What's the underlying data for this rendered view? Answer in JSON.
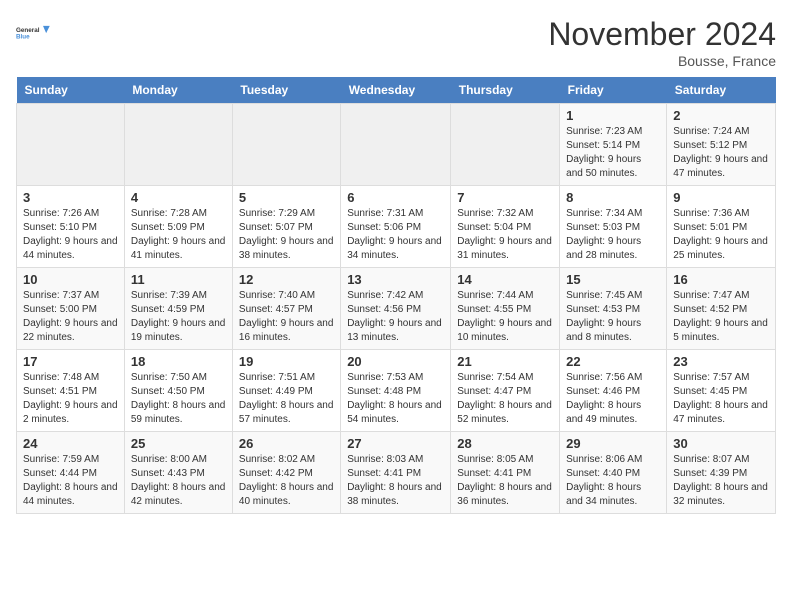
{
  "logo": {
    "line1": "General",
    "line2": "Blue"
  },
  "title": "November 2024",
  "location": "Bousse, France",
  "days_of_week": [
    "Sunday",
    "Monday",
    "Tuesday",
    "Wednesday",
    "Thursday",
    "Friday",
    "Saturday"
  ],
  "weeks": [
    [
      {
        "day": "",
        "info": ""
      },
      {
        "day": "",
        "info": ""
      },
      {
        "day": "",
        "info": ""
      },
      {
        "day": "",
        "info": ""
      },
      {
        "day": "",
        "info": ""
      },
      {
        "day": "1",
        "info": "Sunrise: 7:23 AM\nSunset: 5:14 PM\nDaylight: 9 hours and 50 minutes."
      },
      {
        "day": "2",
        "info": "Sunrise: 7:24 AM\nSunset: 5:12 PM\nDaylight: 9 hours and 47 minutes."
      }
    ],
    [
      {
        "day": "3",
        "info": "Sunrise: 7:26 AM\nSunset: 5:10 PM\nDaylight: 9 hours and 44 minutes."
      },
      {
        "day": "4",
        "info": "Sunrise: 7:28 AM\nSunset: 5:09 PM\nDaylight: 9 hours and 41 minutes."
      },
      {
        "day": "5",
        "info": "Sunrise: 7:29 AM\nSunset: 5:07 PM\nDaylight: 9 hours and 38 minutes."
      },
      {
        "day": "6",
        "info": "Sunrise: 7:31 AM\nSunset: 5:06 PM\nDaylight: 9 hours and 34 minutes."
      },
      {
        "day": "7",
        "info": "Sunrise: 7:32 AM\nSunset: 5:04 PM\nDaylight: 9 hours and 31 minutes."
      },
      {
        "day": "8",
        "info": "Sunrise: 7:34 AM\nSunset: 5:03 PM\nDaylight: 9 hours and 28 minutes."
      },
      {
        "day": "9",
        "info": "Sunrise: 7:36 AM\nSunset: 5:01 PM\nDaylight: 9 hours and 25 minutes."
      }
    ],
    [
      {
        "day": "10",
        "info": "Sunrise: 7:37 AM\nSunset: 5:00 PM\nDaylight: 9 hours and 22 minutes."
      },
      {
        "day": "11",
        "info": "Sunrise: 7:39 AM\nSunset: 4:59 PM\nDaylight: 9 hours and 19 minutes."
      },
      {
        "day": "12",
        "info": "Sunrise: 7:40 AM\nSunset: 4:57 PM\nDaylight: 9 hours and 16 minutes."
      },
      {
        "day": "13",
        "info": "Sunrise: 7:42 AM\nSunset: 4:56 PM\nDaylight: 9 hours and 13 minutes."
      },
      {
        "day": "14",
        "info": "Sunrise: 7:44 AM\nSunset: 4:55 PM\nDaylight: 9 hours and 10 minutes."
      },
      {
        "day": "15",
        "info": "Sunrise: 7:45 AM\nSunset: 4:53 PM\nDaylight: 9 hours and 8 minutes."
      },
      {
        "day": "16",
        "info": "Sunrise: 7:47 AM\nSunset: 4:52 PM\nDaylight: 9 hours and 5 minutes."
      }
    ],
    [
      {
        "day": "17",
        "info": "Sunrise: 7:48 AM\nSunset: 4:51 PM\nDaylight: 9 hours and 2 minutes."
      },
      {
        "day": "18",
        "info": "Sunrise: 7:50 AM\nSunset: 4:50 PM\nDaylight: 8 hours and 59 minutes."
      },
      {
        "day": "19",
        "info": "Sunrise: 7:51 AM\nSunset: 4:49 PM\nDaylight: 8 hours and 57 minutes."
      },
      {
        "day": "20",
        "info": "Sunrise: 7:53 AM\nSunset: 4:48 PM\nDaylight: 8 hours and 54 minutes."
      },
      {
        "day": "21",
        "info": "Sunrise: 7:54 AM\nSunset: 4:47 PM\nDaylight: 8 hours and 52 minutes."
      },
      {
        "day": "22",
        "info": "Sunrise: 7:56 AM\nSunset: 4:46 PM\nDaylight: 8 hours and 49 minutes."
      },
      {
        "day": "23",
        "info": "Sunrise: 7:57 AM\nSunset: 4:45 PM\nDaylight: 8 hours and 47 minutes."
      }
    ],
    [
      {
        "day": "24",
        "info": "Sunrise: 7:59 AM\nSunset: 4:44 PM\nDaylight: 8 hours and 44 minutes."
      },
      {
        "day": "25",
        "info": "Sunrise: 8:00 AM\nSunset: 4:43 PM\nDaylight: 8 hours and 42 minutes."
      },
      {
        "day": "26",
        "info": "Sunrise: 8:02 AM\nSunset: 4:42 PM\nDaylight: 8 hours and 40 minutes."
      },
      {
        "day": "27",
        "info": "Sunrise: 8:03 AM\nSunset: 4:41 PM\nDaylight: 8 hours and 38 minutes."
      },
      {
        "day": "28",
        "info": "Sunrise: 8:05 AM\nSunset: 4:41 PM\nDaylight: 8 hours and 36 minutes."
      },
      {
        "day": "29",
        "info": "Sunrise: 8:06 AM\nSunset: 4:40 PM\nDaylight: 8 hours and 34 minutes."
      },
      {
        "day": "30",
        "info": "Sunrise: 8:07 AM\nSunset: 4:39 PM\nDaylight: 8 hours and 32 minutes."
      }
    ]
  ]
}
